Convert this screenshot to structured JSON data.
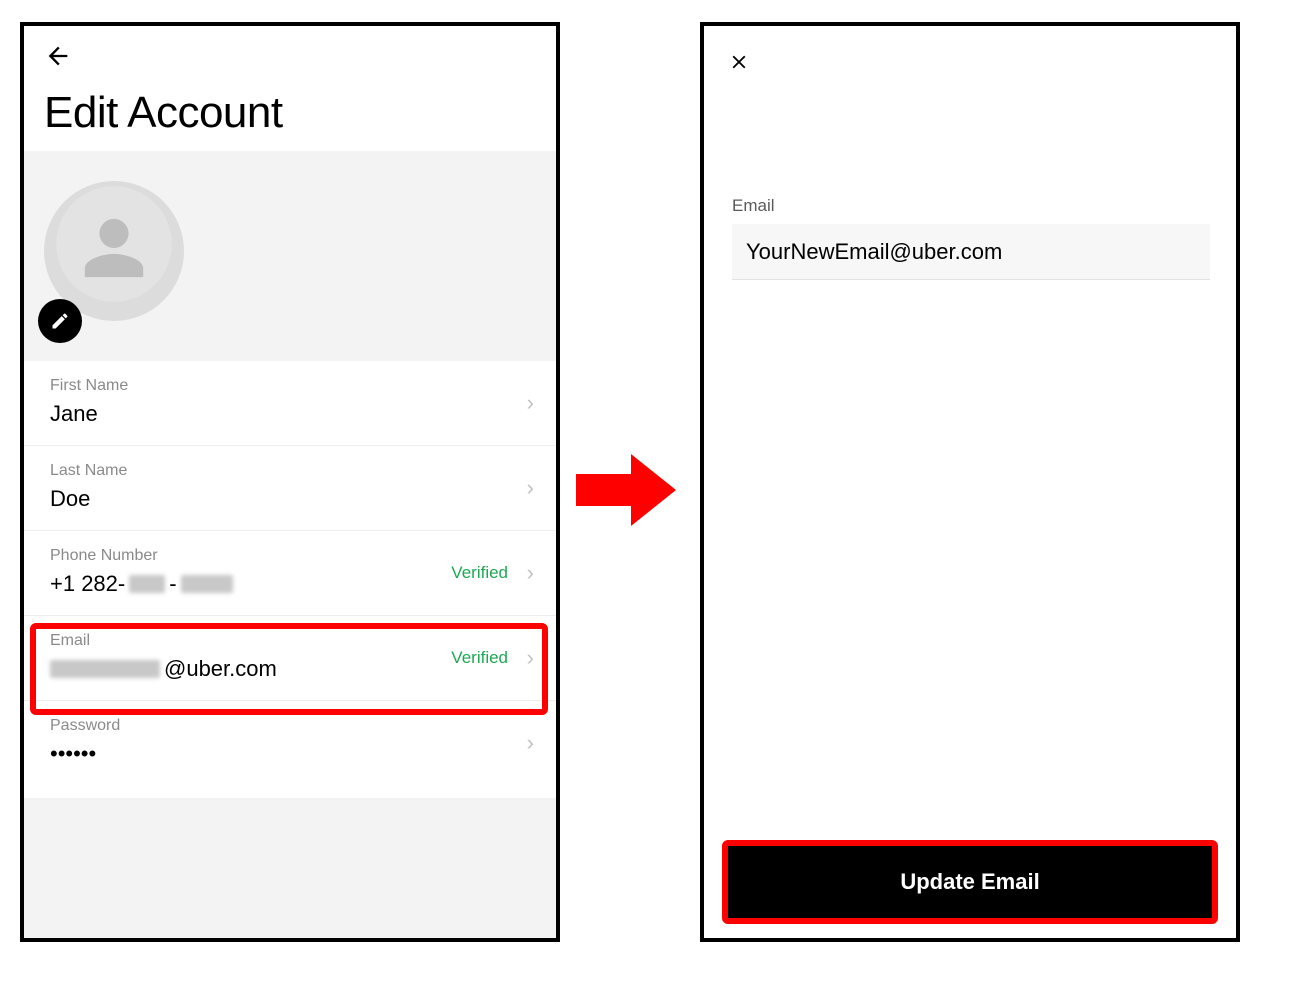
{
  "left": {
    "title": "Edit Account",
    "fields": {
      "first_name": {
        "label": "First Name",
        "value": "Jane"
      },
      "last_name": {
        "label": "Last Name",
        "value": "Doe"
      },
      "phone": {
        "label": "Phone Number",
        "prefix": "+1 282-",
        "verified": "Verified"
      },
      "email": {
        "label": "Email",
        "suffix": "@uber.com",
        "verified": "Verified"
      },
      "password": {
        "label": "Password",
        "value": "••••••"
      }
    }
  },
  "right": {
    "email_label": "Email",
    "email_value": "YourNewEmail@uber.com",
    "button": "Update Email"
  }
}
